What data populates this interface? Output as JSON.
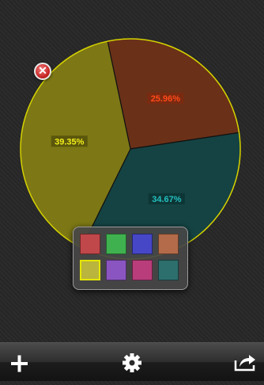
{
  "pie": {
    "slices": [
      {
        "name": "slice-orange",
        "percent_label": "25.96%",
        "value": 25.96,
        "fill": "#6a3118",
        "label_color": "#ff4a1a",
        "label_bg": "#7a2a10"
      },
      {
        "name": "slice-teal",
        "percent_label": "34.67%",
        "value": 34.67,
        "fill": "#154343",
        "label_color": "#22c0c0",
        "label_bg": "#0e3535"
      },
      {
        "name": "slice-olive",
        "percent_label": "39.35%",
        "value": 39.35,
        "fill": "#7d7815",
        "label_color": "#f2ee1a",
        "label_bg": "#5a560c"
      }
    ],
    "outline_color": "#d8d400"
  },
  "delete_button": {
    "symbol": "✕",
    "icon": "close-icon"
  },
  "palette": {
    "colors": [
      "#c0474a",
      "#3fb14f",
      "#4647c7",
      "#b36b4a",
      "#b9b53d",
      "#8a55c0",
      "#b93d7a",
      "#2d6f6d"
    ],
    "selected_index": 4,
    "selected_border": "#e6e600"
  },
  "toolbar": {
    "add_icon": "plus-icon",
    "settings_icon": "gear-icon",
    "share_icon": "share-icon"
  }
}
